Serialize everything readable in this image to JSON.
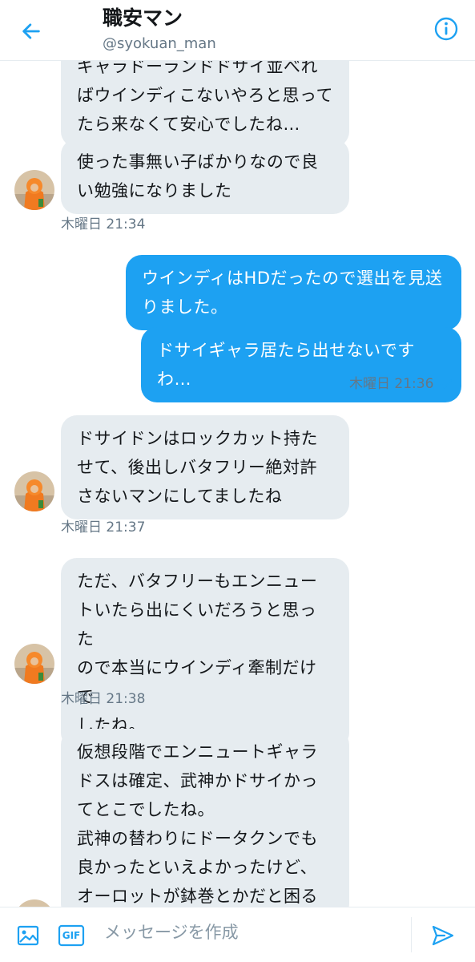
{
  "header": {
    "title": "職安マン",
    "handle": "@syokuan_man",
    "back_icon": "arrow-left-icon",
    "info_icon": "info-icon",
    "accent": "#1da1f2"
  },
  "messages": [
    {
      "id": 1,
      "direction": "in",
      "lines": [
        "ギャラドーランドドサイ並べれ",
        "ばウインディこないやろと思って",
        "たら来なくて安心でしたね…"
      ]
    },
    {
      "id": 2,
      "direction": "in",
      "lines": [
        "使った事無い子ばかりなので良",
        "い勉強になりました"
      ]
    },
    {
      "id": 3,
      "direction": "out",
      "lines": [
        "ウインディはHDだったので選出を見送",
        "りました。"
      ]
    },
    {
      "id": 4,
      "direction": "out",
      "lines": [
        "ドサイギャラ居たら出せないですわ…"
      ]
    },
    {
      "id": 5,
      "direction": "in",
      "lines": [
        "ドサイドンはロックカット持た",
        "せて、後出しバタフリー絶対許",
        "さないマンにしてましたね"
      ]
    },
    {
      "id": 6,
      "direction": "in",
      "lines": [
        "ただ、バタフリーもエンニュー",
        "トいたら出にくいだろうと思った",
        "ので本当にウインディ牽制だけで",
        "したね。"
      ]
    },
    {
      "id": 7,
      "direction": "in",
      "lines": [
        "仮想段階でエンニュートギャラ",
        "ドスは確定、武神かドサイかっ",
        "てとこでしたね。",
        "武神の替わりにドータクンでも",
        "良かったといえよかったけど、",
        "オーロットが鉢巻とかだと困る"
      ]
    }
  ],
  "timestamps": {
    "t1": "木曜日 21:34",
    "t2": "木曜日 21:36",
    "t3": "木曜日 21:37",
    "t4": "木曜日 21:38"
  },
  "read_check_icon": "check-icon",
  "composer": {
    "placeholder": "メッセージを作成",
    "gif_label": "GIF",
    "image_icon": "image-icon",
    "send_icon": "send-icon"
  }
}
